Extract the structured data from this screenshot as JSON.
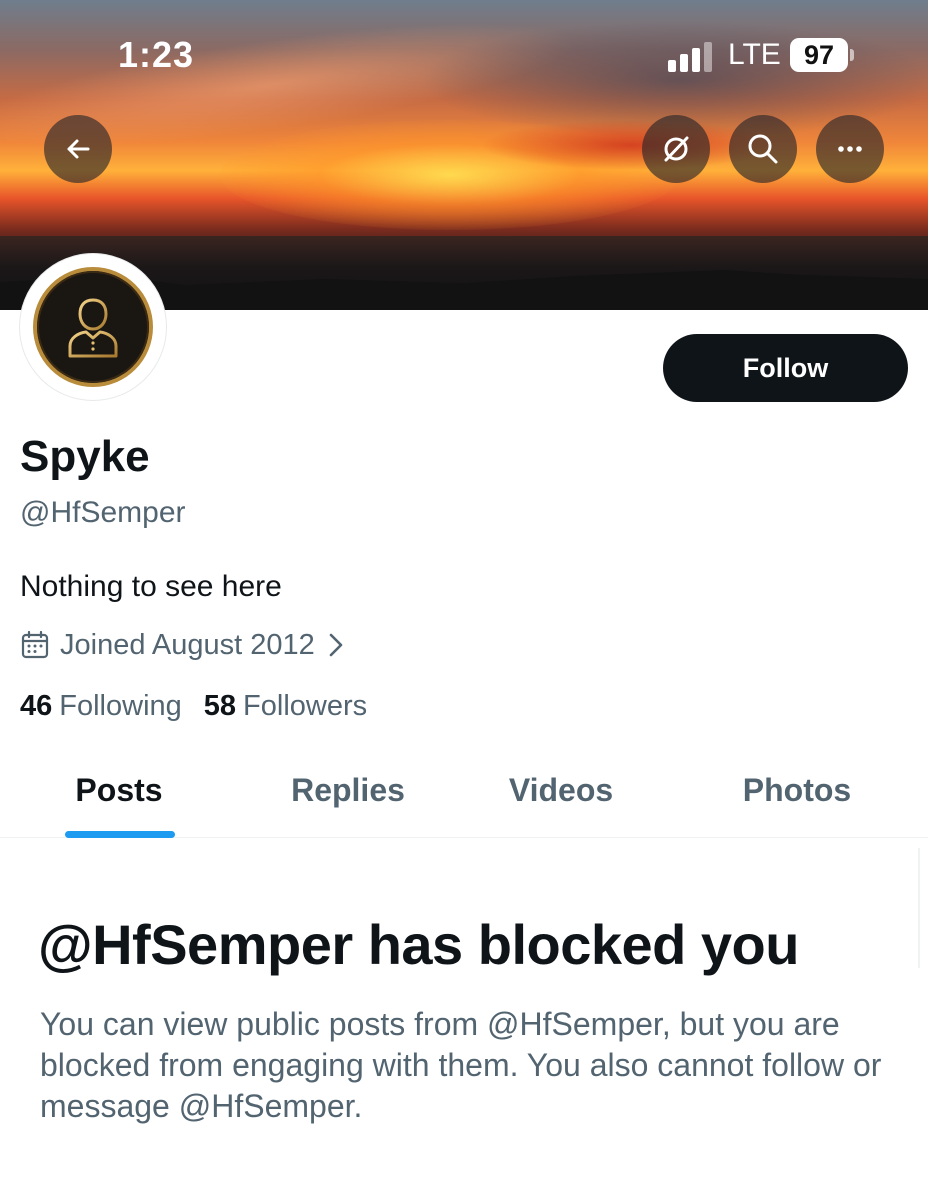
{
  "status_bar": {
    "time": "1:23",
    "network": "LTE",
    "battery": "97"
  },
  "header": {
    "back_icon": "arrow-left-icon",
    "grok_icon": "grok-icon",
    "search_icon": "search-icon",
    "more_icon": "more-dots-icon"
  },
  "profile": {
    "display_name": "Spyke",
    "handle": "@HfSemper",
    "bio": "Nothing to see here",
    "joined": "Joined August 2012",
    "follow_label": "Follow",
    "following_count": "46",
    "following_label": "Following",
    "followers_count": "58",
    "followers_label": "Followers"
  },
  "tabs": [
    {
      "label": "Posts",
      "active": true
    },
    {
      "label": "Replies",
      "active": false
    },
    {
      "label": "Videos",
      "active": false
    },
    {
      "label": "Photos",
      "active": false
    }
  ],
  "blocked": {
    "title": "@HfSemper has blocked you",
    "body": "You can view public posts from @HfSemper, but you are blocked from engaging with them. You also cannot follow or message @HfSemper."
  },
  "colors": {
    "accent": "#1d9bf0",
    "text_primary": "#0f1419",
    "text_secondary": "#536471",
    "follow_bg": "#0f1419"
  }
}
